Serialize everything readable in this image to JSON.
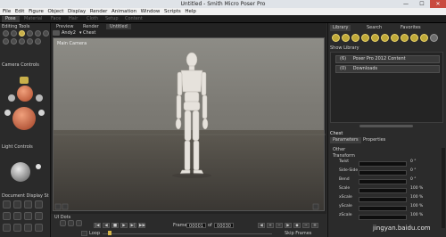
{
  "window": {
    "title": "Untitled - Smith Micro Poser Pro",
    "min": "—",
    "max": "☐",
    "close": "✕"
  },
  "menu": [
    "File",
    "Edit",
    "Figure",
    "Object",
    "Display",
    "Render",
    "Animation",
    "Window",
    "Scripts",
    "Help"
  ],
  "rooms": [
    "Pose",
    "Material",
    "Face",
    "Hair",
    "Cloth",
    "Setup",
    "Content"
  ],
  "left_panel": {
    "editing_tools": "Editing Tools",
    "camera_controls": "Camera Controls",
    "light_controls": "Light Controls",
    "document_display": "Document Display St"
  },
  "document": {
    "tabs": [
      "Preview",
      "Render",
      "Untitled"
    ],
    "figure_select": "Andy2",
    "part_select": "Chest",
    "camera_label": "Main Camera"
  },
  "bottom": {
    "ui_dots": "UI Dots",
    "frame_label": "Frame",
    "frame_current": "00001",
    "frame_sep": "of",
    "frame_total": "00030",
    "loop": "Loop",
    "skip_frames": "Skip Frames"
  },
  "right_panel": {
    "tabs": [
      "Library",
      "Search",
      "Favorites"
    ],
    "show_library": "Show Library",
    "library_rows": [
      {
        "count": "(6)",
        "label": "Poser Pro 2012 Content"
      },
      {
        "count": "(0)",
        "label": "Downloads"
      }
    ],
    "param_header": "Chest",
    "param_tabs": [
      "Parameters",
      "Properties"
    ],
    "other": "Other",
    "transform": "Transform",
    "params": [
      {
        "label": "Twist",
        "value": "0 °"
      },
      {
        "label": "Side-Side",
        "value": "0 °"
      },
      {
        "label": "Bend",
        "value": "0 °"
      },
      {
        "label": "Scale",
        "value": "100 %"
      },
      {
        "label": "xScale",
        "value": "100 %"
      },
      {
        "label": "yScale",
        "value": "100 %"
      },
      {
        "label": "zScale",
        "value": "100 %"
      }
    ]
  },
  "watermark": "jingyan.baidu.com"
}
